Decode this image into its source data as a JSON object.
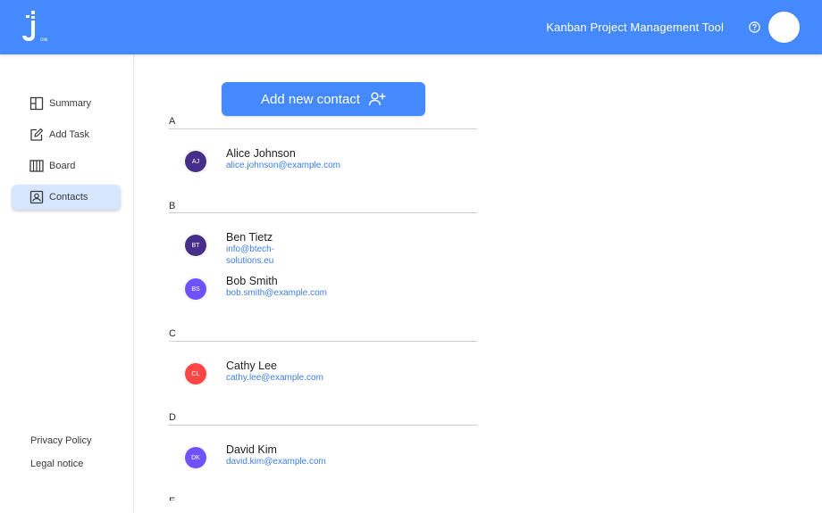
{
  "header": {
    "app_title": "Kanban Project Management Tool",
    "colors": {
      "brand": "#4589ff"
    },
    "icons": [
      "join-logo-icon",
      "help-icon",
      "user-avatar"
    ]
  },
  "sidebar": {
    "items": [
      {
        "label": "Summary",
        "icon": "summary-icon",
        "active": false
      },
      {
        "label": "Add Task",
        "icon": "add-task-icon",
        "active": false
      },
      {
        "label": "Board",
        "icon": "board-icon",
        "active": false
      },
      {
        "label": "Contacts",
        "icon": "contacts-icon",
        "active": true
      }
    ],
    "footer": {
      "privacy": "Privacy Policy",
      "legal": "Legal notice"
    }
  },
  "main": {
    "add_button_label": "Add new contact",
    "groups": [
      {
        "letter": "A",
        "contacts": [
          {
            "initials": "AJ",
            "name": "Alice Johnson",
            "email": "alice.johnson@example.com",
            "color": "#462f8a"
          }
        ]
      },
      {
        "letter": "B",
        "contacts": [
          {
            "initials": "BT",
            "name": "Ben Tietz",
            "email": "info@btech-solutions.eu",
            "color": "#462f8a"
          },
          {
            "initials": "BS",
            "name": "Bob Smith",
            "email": "bob.smith@example.com",
            "color": "#6e52ff"
          }
        ]
      },
      {
        "letter": "C",
        "contacts": [
          {
            "initials": "CL",
            "name": "Cathy Lee",
            "email": "cathy.lee@example.com",
            "color": "#ff4646"
          }
        ]
      },
      {
        "letter": "D",
        "contacts": [
          {
            "initials": "DK",
            "name": "David Kim",
            "email": "david.kim@example.com",
            "color": "#6e52ff"
          }
        ]
      },
      {
        "letter": "E",
        "contacts": []
      }
    ]
  }
}
